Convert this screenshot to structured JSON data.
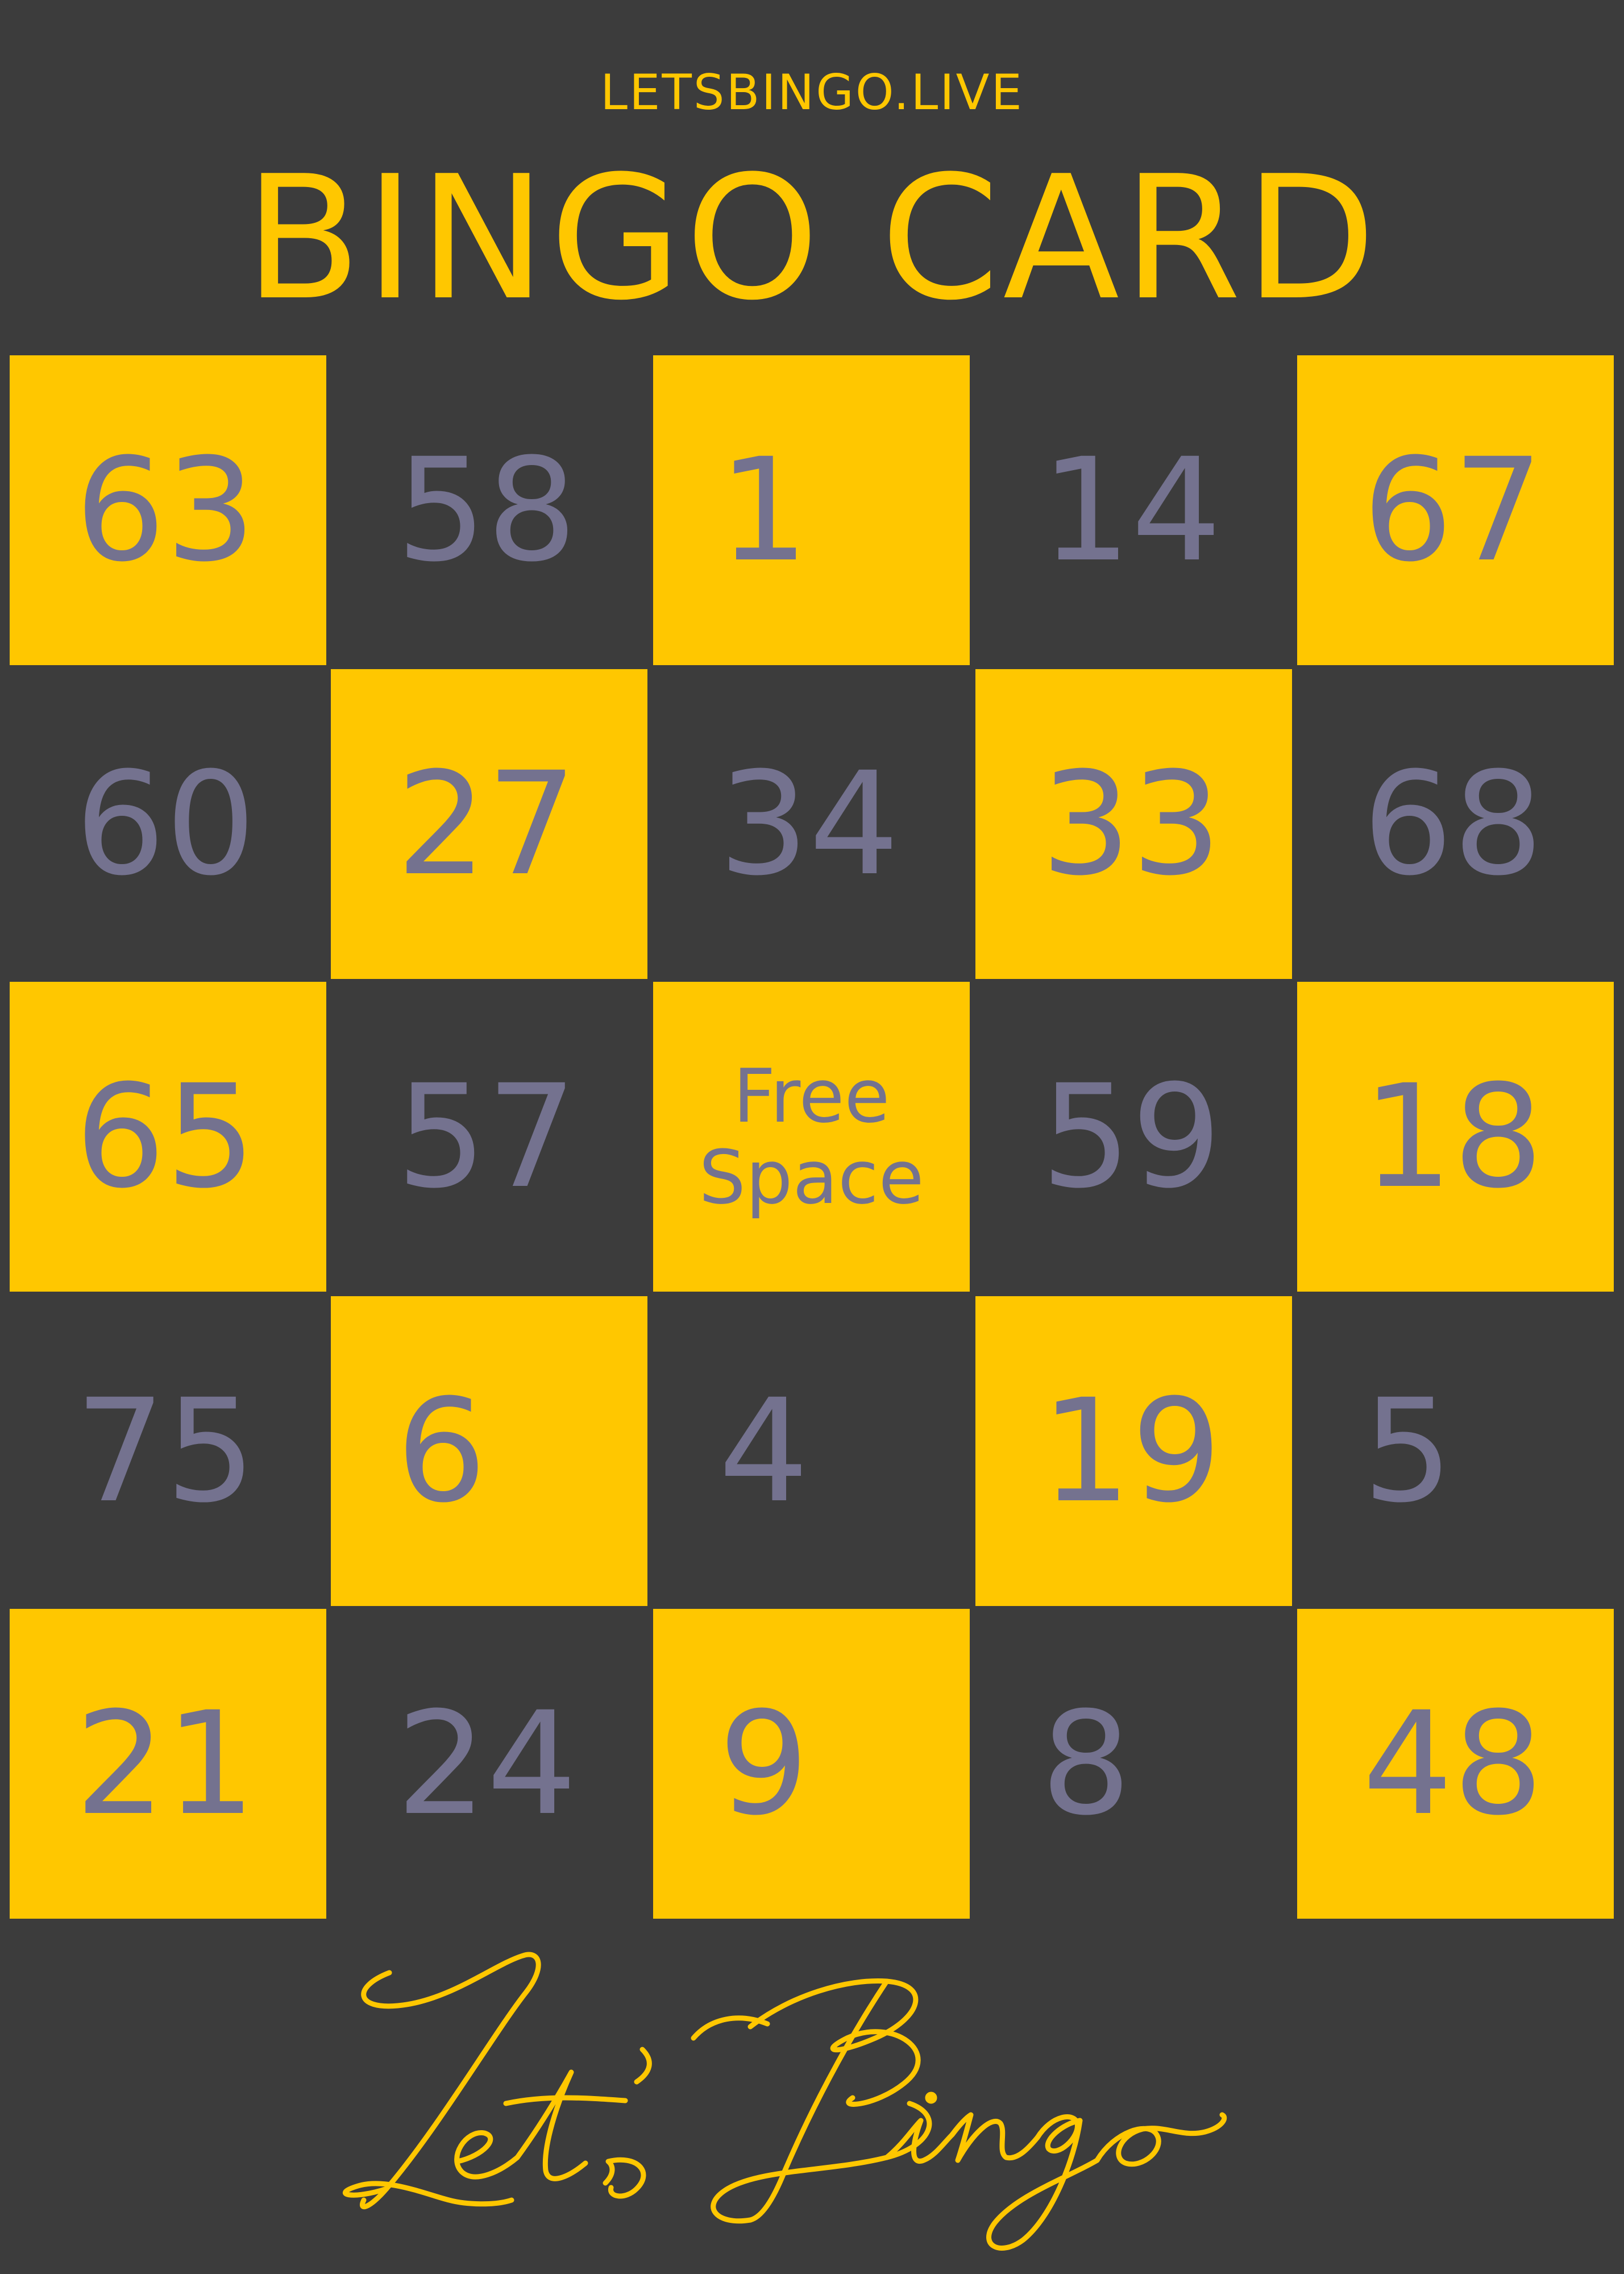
{
  "header": {
    "site": "LETSBINGO.LIVE",
    "title": "BINGO CARD"
  },
  "colors": {
    "background": "#3c3c3c",
    "accent": "#ffc700",
    "number": "#74728f"
  },
  "card": {
    "rows": [
      [
        "63",
        "58",
        "1",
        "14",
        "67"
      ],
      [
        "60",
        "27",
        "34",
        "33",
        "68"
      ],
      [
        "65",
        "57",
        "Free Space",
        "59",
        "18"
      ],
      [
        "75",
        "6",
        "4",
        "19",
        "5"
      ],
      [
        "21",
        "24",
        "9",
        "8",
        "48"
      ]
    ],
    "free_space": {
      "line1": "Free",
      "line2": "Space"
    }
  },
  "footer": {
    "signature": "Let's Bingo"
  }
}
